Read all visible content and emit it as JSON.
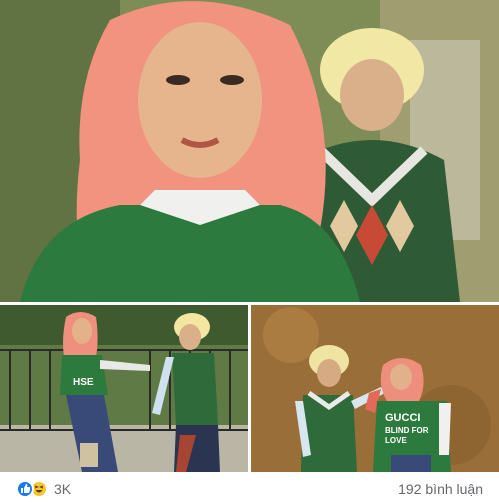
{
  "reactions": {
    "icons": [
      "like-icon",
      "haha-icon"
    ],
    "count": "3K",
    "colors": {
      "like": "#1877f2",
      "haha": "#f7c52f"
    }
  },
  "comments": {
    "count_label": "192 bình luận"
  },
  "photos": {
    "left_shirt_text": "HSE",
    "right_shirt_lines": [
      "GUCCI",
      "BLIND FOR",
      "LOVE"
    ]
  }
}
